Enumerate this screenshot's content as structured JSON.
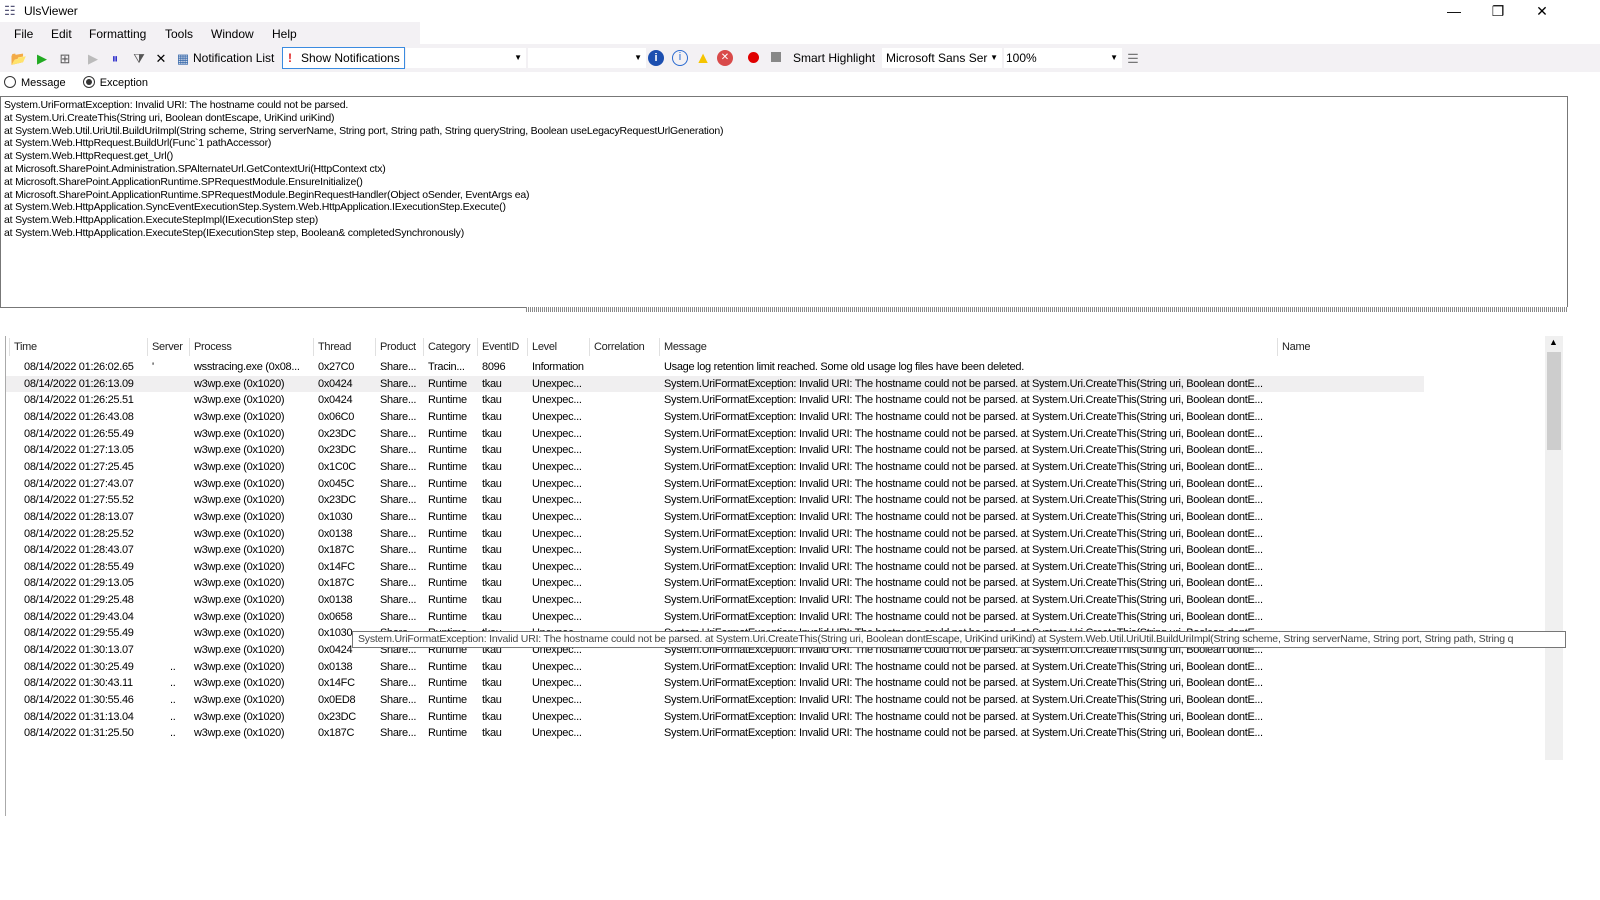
{
  "window": {
    "title": "UlsViewer",
    "minimize": "—",
    "maximize": "❐",
    "close": "✕"
  },
  "menu": [
    "File",
    "Edit",
    "Formatting",
    "Tools",
    "Window",
    "Help"
  ],
  "toolbar": {
    "notification_list": "Notification List",
    "show_notifications": "Show Notifications",
    "filter1": "",
    "filter2": "",
    "smart_highlight": "Smart Highlight",
    "font": "Microsoft Sans Ser",
    "zoom": "100%"
  },
  "view_mode": {
    "options": [
      "Message",
      "Exception"
    ],
    "selected": "Exception"
  },
  "detail_lines": [
    "System.UriFormatException: Invalid URI: The hostname could not be parsed.",
    "at System.Uri.CreateThis(String uri, Boolean dontEscape, UriKind uriKind)",
    "at System.Web.Util.UriUtil.BuildUriImpl(String scheme, String serverName, String port, String path, String queryString, Boolean useLegacyRequestUrlGeneration)",
    "at System.Web.HttpRequest.BuildUrl(Func`1 pathAccessor)",
    "at System.Web.HttpRequest.get_Url()",
    "at Microsoft.SharePoint.Administration.SPAlternateUrl.GetContextUri(HttpContext ctx)",
    "at Microsoft.SharePoint.ApplicationRuntime.SPRequestModule.EnsureInitialize()",
    "at Microsoft.SharePoint.ApplicationRuntime.SPRequestModule.BeginRequestHandler(Object oSender, EventArgs ea)",
    "at System.Web.HttpApplication.SyncEventExecutionStep.System.Web.HttpApplication.IExecutionStep.Execute()",
    "at System.Web.HttpApplication.ExecuteStepImpl(IExecutionStep step)",
    "at System.Web.HttpApplication.ExecuteStep(IExecutionStep step, Boolean& completedSynchronously)"
  ],
  "columns": [
    "Time",
    "Server",
    "Process",
    "Thread",
    "Product",
    "Category",
    "EventID",
    "Level",
    "Correlation",
    "Message",
    "Name"
  ],
  "rows": [
    [
      "08/14/2022 01:26:02.65",
      "'",
      "wsstracing.exe (0x08...",
      "0x27C0",
      "Share...",
      "Tracin...",
      "8096",
      "Information",
      "",
      "Usage log retention limit reached.  Some old usage log files have been deleted.",
      ""
    ],
    [
      "08/14/2022 01:26:13.09",
      "",
      "w3wp.exe (0x1020)",
      "0x0424",
      "Share...",
      "Runtime",
      "tkau",
      "Unexpec...",
      "",
      "System.UriFormatException: Invalid URI: The hostname could not be parsed.    at System.Uri.CreateThis(String uri, Boolean dontE...",
      ""
    ],
    [
      "08/14/2022 01:26:25.51",
      "",
      "w3wp.exe (0x1020)",
      "0x0424",
      "Share...",
      "Runtime",
      "tkau",
      "Unexpec...",
      "",
      "System.UriFormatException: Invalid URI: The hostname could not be parsed.    at System.Uri.CreateThis(String uri, Boolean dontE...",
      ""
    ],
    [
      "08/14/2022 01:26:43.08",
      "",
      "w3wp.exe (0x1020)",
      "0x06C0",
      "Share...",
      "Runtime",
      "tkau",
      "Unexpec...",
      "",
      "System.UriFormatException: Invalid URI: The hostname could not be parsed.    at System.Uri.CreateThis(String uri, Boolean dontE...",
      ""
    ],
    [
      "08/14/2022 01:26:55.49",
      "",
      "w3wp.exe (0x1020)",
      "0x23DC",
      "Share...",
      "Runtime",
      "tkau",
      "Unexpec...",
      "",
      "System.UriFormatException: Invalid URI: The hostname could not be parsed.    at System.Uri.CreateThis(String uri, Boolean dontE...",
      ""
    ],
    [
      "08/14/2022 01:27:13.05",
      "",
      "w3wp.exe (0x1020)",
      "0x23DC",
      "Share...",
      "Runtime",
      "tkau",
      "Unexpec...",
      "",
      "System.UriFormatException: Invalid URI: The hostname could not be parsed.    at System.Uri.CreateThis(String uri, Boolean dontE...",
      ""
    ],
    [
      "08/14/2022 01:27:25.45",
      "",
      "w3wp.exe (0x1020)",
      "0x1C0C",
      "Share...",
      "Runtime",
      "tkau",
      "Unexpec...",
      "",
      "System.UriFormatException: Invalid URI: The hostname could not be parsed.    at System.Uri.CreateThis(String uri, Boolean dontE...",
      ""
    ],
    [
      "08/14/2022 01:27:43.07",
      "",
      "w3wp.exe (0x1020)",
      "0x045C",
      "Share...",
      "Runtime",
      "tkau",
      "Unexpec...",
      "",
      "System.UriFormatException: Invalid URI: The hostname could not be parsed.    at System.Uri.CreateThis(String uri, Boolean dontE...",
      ""
    ],
    [
      "08/14/2022 01:27:55.52",
      "",
      "w3wp.exe (0x1020)",
      "0x23DC",
      "Share...",
      "Runtime",
      "tkau",
      "Unexpec...",
      "",
      "System.UriFormatException: Invalid URI: The hostname could not be parsed.    at System.Uri.CreateThis(String uri, Boolean dontE...",
      ""
    ],
    [
      "08/14/2022 01:28:13.07",
      "",
      "w3wp.exe (0x1020)",
      "0x1030",
      "Share...",
      "Runtime",
      "tkau",
      "Unexpec...",
      "",
      "System.UriFormatException: Invalid URI: The hostname could not be parsed.    at System.Uri.CreateThis(String uri, Boolean dontE...",
      ""
    ],
    [
      "08/14/2022 01:28:25.52",
      "",
      "w3wp.exe (0x1020)",
      "0x0138",
      "Share...",
      "Runtime",
      "tkau",
      "Unexpec...",
      "",
      "System.UriFormatException: Invalid URI: The hostname could not be parsed.    at System.Uri.CreateThis(String uri, Boolean dontE...",
      ""
    ],
    [
      "08/14/2022 01:28:43.07",
      "",
      "w3wp.exe (0x1020)",
      "0x187C",
      "Share...",
      "Runtime",
      "tkau",
      "Unexpec...",
      "",
      "System.UriFormatException: Invalid URI: The hostname could not be parsed.    at System.Uri.CreateThis(String uri, Boolean dontE...",
      ""
    ],
    [
      "08/14/2022 01:28:55.49",
      "",
      "w3wp.exe (0x1020)",
      "0x14FC",
      "Share...",
      "Runtime",
      "tkau",
      "Unexpec...",
      "",
      "System.UriFormatException: Invalid URI: The hostname could not be parsed.    at System.Uri.CreateThis(String uri, Boolean dontE...",
      ""
    ],
    [
      "08/14/2022 01:29:13.05",
      "",
      "w3wp.exe (0x1020)",
      "0x187C",
      "Share...",
      "Runtime",
      "tkau",
      "Unexpec...",
      "",
      "System.UriFormatException: Invalid URI: The hostname could not be parsed.    at System.Uri.CreateThis(String uri, Boolean dontE...",
      ""
    ],
    [
      "08/14/2022 01:29:25.48",
      "",
      "w3wp.exe (0x1020)",
      "0x0138",
      "Share...",
      "Runtime",
      "tkau",
      "Unexpec...",
      "",
      "System.UriFormatException: Invalid URI: The hostname could not be parsed.    at System.Uri.CreateThis(String uri, Boolean dontE...",
      ""
    ],
    [
      "08/14/2022 01:29:43.04",
      "",
      "w3wp.exe (0x1020)",
      "0x0658",
      "Share...",
      "Runtime",
      "tkau",
      "Unexpec...",
      "",
      "System.UriFormatException: Invalid URI: The hostname could not be parsed.    at System.Uri.CreateThis(String uri, Boolean dontE...",
      ""
    ],
    [
      "08/14/2022 01:29:55.49",
      "",
      "w3wp.exe (0x1020)",
      "0x1030",
      "Share...",
      "Runtime",
      "tkau",
      "Unexpec...",
      "",
      "System.UriFormatException: Invalid URI: The hostname could not be parsed.    at System.Uri.CreateThis(String uri, Boolean dontE...",
      ""
    ],
    [
      "08/14/2022 01:30:13.07",
      "",
      "w3wp.exe (0x1020)",
      "0x0424",
      "Share...",
      "Runtime",
      "tkau",
      "Unexpec...",
      "",
      "System.UriFormatException: Invalid URI: The hostname could not be parsed.    at System.Uri.CreateThis(String uri, Boolean dontE...",
      ""
    ],
    [
      "08/14/2022 01:30:25.49",
      "..",
      "w3wp.exe (0x1020)",
      "0x0138",
      "Share...",
      "Runtime",
      "tkau",
      "Unexpec...",
      "",
      "System.UriFormatException: Invalid URI: The hostname could not be parsed.    at System.Uri.CreateThis(String uri, Boolean dontE...",
      ""
    ],
    [
      "08/14/2022 01:30:43.11",
      "..",
      "w3wp.exe (0x1020)",
      "0x14FC",
      "Share...",
      "Runtime",
      "tkau",
      "Unexpec...",
      "",
      "System.UriFormatException: Invalid URI: The hostname could not be parsed.    at System.Uri.CreateThis(String uri, Boolean dontE...",
      ""
    ],
    [
      "08/14/2022 01:30:55.46",
      "..",
      "w3wp.exe (0x1020)",
      "0x0ED8",
      "Share...",
      "Runtime",
      "tkau",
      "Unexpec...",
      "",
      "System.UriFormatException: Invalid URI: The hostname could not be parsed.    at System.Uri.CreateThis(String uri, Boolean dontE...",
      ""
    ],
    [
      "08/14/2022 01:31:13.04",
      "..",
      "w3wp.exe (0x1020)",
      "0x23DC",
      "Share...",
      "Runtime",
      "tkau",
      "Unexpec...",
      "",
      "System.UriFormatException: Invalid URI: The hostname could not be parsed.    at System.Uri.CreateThis(String uri, Boolean dontE...",
      ""
    ],
    [
      "08/14/2022 01:31:25.50",
      "..",
      "w3wp.exe (0x1020)",
      "0x187C",
      "Share...",
      "Runtime",
      "tkau",
      "Unexpec...",
      "",
      "System.UriFormatException: Invalid URI: The hostname could not be parsed.    at System.Uri.CreateThis(String uri, Boolean dontE...",
      ""
    ]
  ],
  "selected_row": 1,
  "tooltip": "System.UriFormatException: Invalid URI: The hostname could not be parsed.    at System.Uri.CreateThis(String uri, Boolean dontEscape, UriKind uriKind)    at System.Web.Util.UriUtil.BuildUriImpl(String scheme, String serverName, String port, String path, String q",
  "colors": {
    "record": "#e00000",
    "stop": "#888888",
    "warning": "#f5c400",
    "error": "#d94a4a",
    "info": "#1c4fb0"
  }
}
